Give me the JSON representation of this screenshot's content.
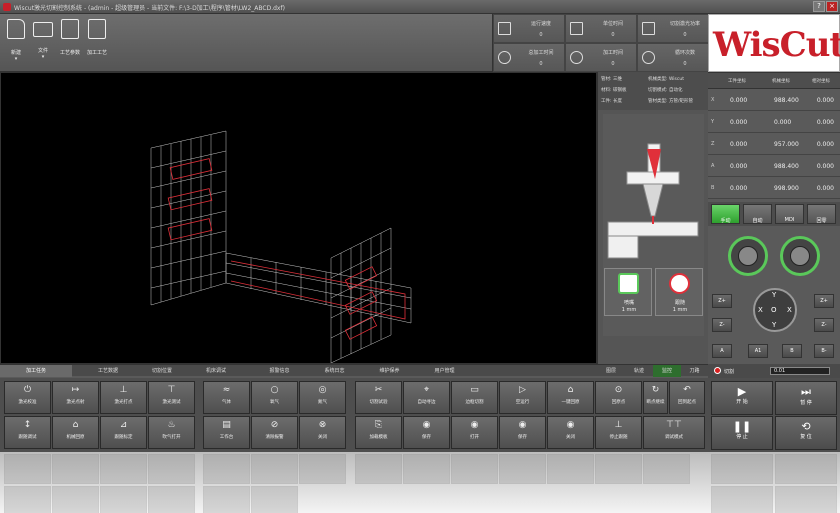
{
  "window": {
    "title": "Wiscut激光切割控制系统 - (admin - 超级管理员 - 当前文件: F:\\3-D加工\\程序\\管材\\LW2_ABCD.dxf)",
    "controls": [
      "?",
      "×"
    ]
  },
  "toolbar": {
    "buttons": [
      {
        "label": "新建",
        "icon": "new-file-icon",
        "has_dropdown": true
      },
      {
        "label": "文件",
        "icon": "open-folder-icon",
        "has_dropdown": true
      },
      {
        "label": "工艺参数",
        "icon": "process-params-icon",
        "has_dropdown": false
      },
      {
        "label": "加工工艺",
        "icon": "process-icon",
        "has_dropdown": false
      }
    ]
  },
  "status": {
    "items": [
      {
        "label": "运行速度",
        "value": "0",
        "icon": "speed-icon"
      },
      {
        "label": "单位时间",
        "value": "0",
        "icon": "laser-head-icon"
      },
      {
        "label": "切割激光功率",
        "value": "0",
        "icon": "power-icon"
      },
      {
        "label": "总加工时间",
        "value": "0",
        "icon": "timer-icon"
      },
      {
        "label": "加工时间",
        "value": "0",
        "icon": "clock-icon"
      },
      {
        "label": "循环次数",
        "value": "0",
        "icon": "cycle-icon"
      }
    ]
  },
  "logo": {
    "text": "WisCut"
  },
  "info": {
    "rows": [
      [
        "管材: 三维",
        "机械类型: Wiscut"
      ],
      [
        "材料: 碳钢板",
        "切割模式: 自动化"
      ],
      [
        "工件: 长度",
        "管材类型: 方管/矩形管"
      ]
    ]
  },
  "chips": [
    {
      "label": "喷嘴",
      "value": "1 mm",
      "icon": "nozzle-icon"
    },
    {
      "label": "跟随",
      "value": "1 mm",
      "icon": "follow-icon"
    }
  ],
  "coords": {
    "headers": [
      "工件坐标",
      "机械坐标",
      "相对坐标"
    ],
    "rows": [
      {
        "axis": "X",
        "machine": "0.000",
        "work": "988.400",
        "value": "0.000"
      },
      {
        "axis": "Y",
        "machine": "0.000",
        "work": "0.000",
        "value": "0.000"
      },
      {
        "axis": "Z",
        "machine": "0.000",
        "work": "957.000",
        "value": "0.000"
      },
      {
        "axis": "A",
        "machine": "0.000",
        "work": "988.400",
        "value": "0.000"
      },
      {
        "axis": "B",
        "machine": "0.000",
        "work": "998.900",
        "value": "0.000"
      }
    ]
  },
  "modes": [
    "手动",
    "自动",
    "MDI",
    "回零"
  ],
  "jog": {
    "center": "O",
    "keys": [
      "Z+",
      "Z-",
      "A",
      "A1",
      "B",
      "B-"
    ],
    "dpad": [
      "Y",
      "Y",
      "X",
      "X"
    ]
  },
  "tabs": {
    "left": [
      "加工任务",
      "工艺数据",
      "切割位置",
      "机床调试",
      "报警信息",
      "系统日志",
      "维护保养",
      "用户管理"
    ],
    "right": [
      "图层",
      "轨迹",
      "监控",
      "刀路"
    ]
  },
  "progress": {
    "label": "切割",
    "value": "0.01"
  },
  "buttons_row1": [
    "激光校准",
    "激光点射",
    "激光打点",
    "激光测试",
    "气体",
    "氧气",
    "氮气",
    "切割试验",
    "自动寻边",
    "边框切割",
    "空运行",
    "一键回原",
    "回原点",
    "断点继续",
    "回到起点"
  ],
  "buttons_row2": [
    "跟随调试",
    "机械回原",
    "跟随标定",
    "吹气打开",
    "工作台",
    "清除报警",
    "关闭",
    "加载模板",
    "保存",
    "打开",
    "保存",
    "关闭",
    "停止跟随",
    "调试模式"
  ],
  "run": [
    {
      "label": "开 始",
      "icon": "play-icon"
    },
    {
      "label": "暂 停",
      "icon": "pause-icon"
    },
    {
      "label": "停 止",
      "icon": "stop-icon"
    },
    {
      "label": "复 位",
      "icon": "reset-icon"
    }
  ]
}
